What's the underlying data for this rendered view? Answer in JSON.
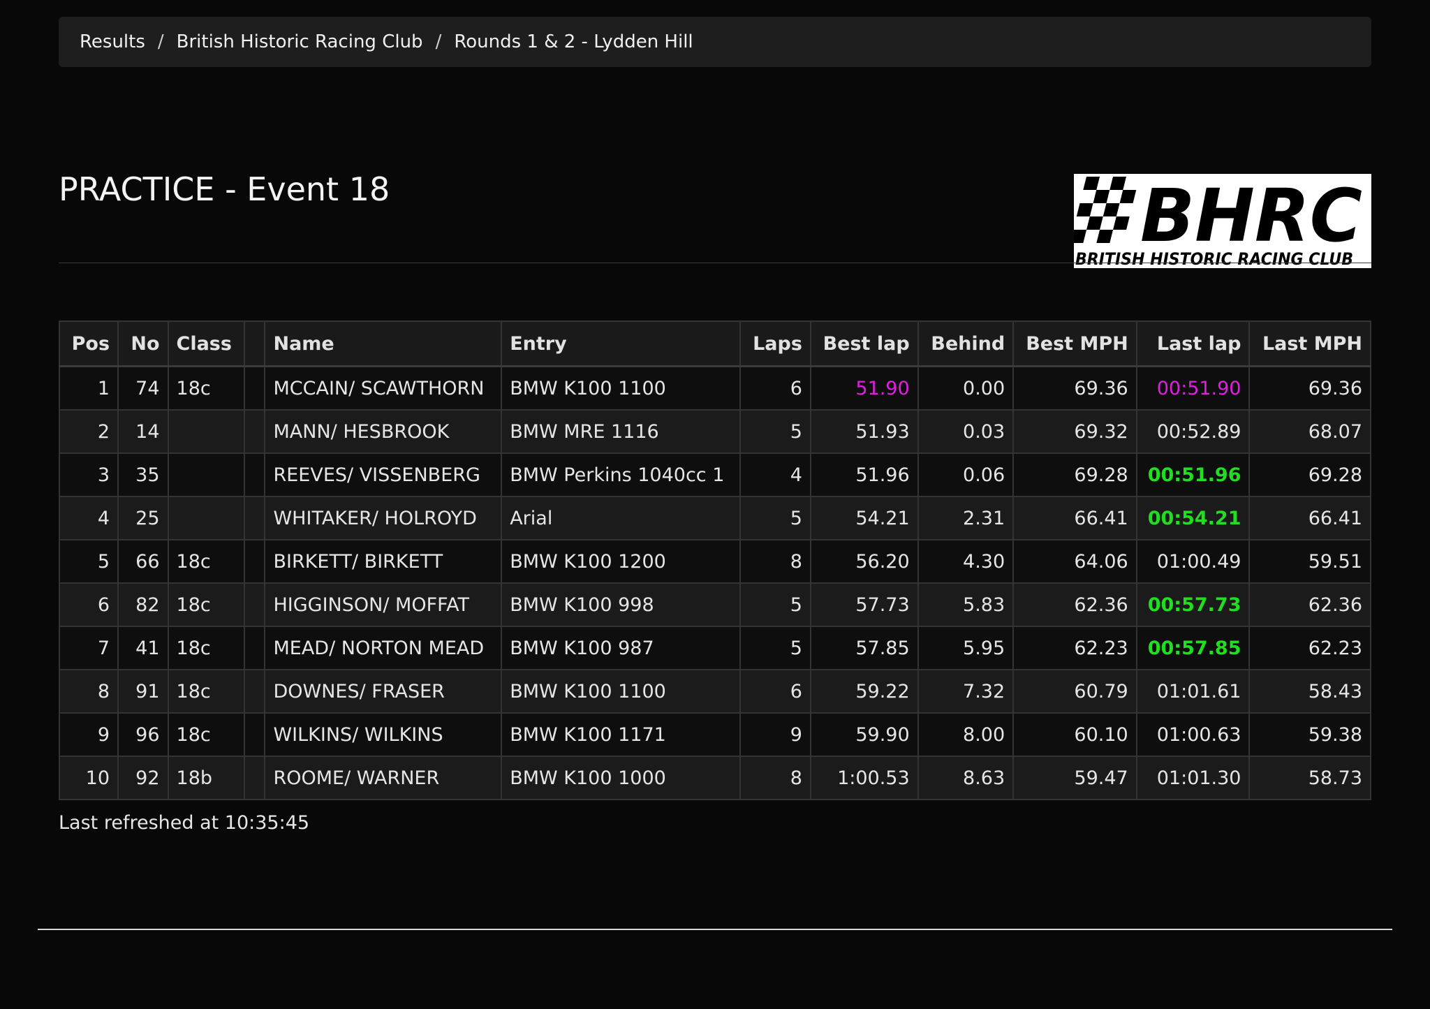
{
  "breadcrumb": [
    "Results",
    "British Historic Racing Club",
    "Rounds 1 & 2 - Lydden Hill"
  ],
  "breadcrumb_separator": "/",
  "title": "PRACTICE - Event 18",
  "logo": {
    "main_text": "BHRC",
    "sub_text": "BRITISH HISTORIC RACING CLUB"
  },
  "colors": {
    "best_overall": "#e11ee1",
    "personal_best": "#22dd22",
    "background": "#080808"
  },
  "table": {
    "headers": [
      "Pos",
      "No",
      "Class",
      "",
      "Name",
      "Entry",
      "Laps",
      "Best lap",
      "Behind",
      "Best MPH",
      "Last lap",
      "Last MPH"
    ],
    "rows": [
      {
        "pos": "1",
        "no": "74",
        "class": "18c",
        "flag": "",
        "name": "MCCAIN/ SCAWTHORN",
        "entry": "BMW K100 1100",
        "laps": "6",
        "best_lap": "51.90",
        "behind": "0.00",
        "best_mph": "69.36",
        "last_lap": "00:51.90",
        "last_mph": "69.36",
        "best_status": "overall",
        "last_status": "overall"
      },
      {
        "pos": "2",
        "no": "14",
        "class": "",
        "flag": "",
        "name": "MANN/ HESBROOK",
        "entry": "BMW MRE 1116",
        "laps": "5",
        "best_lap": "51.93",
        "behind": "0.03",
        "best_mph": "69.32",
        "last_lap": "00:52.89",
        "last_mph": "68.07",
        "best_status": "",
        "last_status": ""
      },
      {
        "pos": "3",
        "no": "35",
        "class": "",
        "flag": "",
        "name": "REEVES/ VISSENBERG",
        "entry": "BMW Perkins 1040cc 1",
        "laps": "4",
        "best_lap": "51.96",
        "behind": "0.06",
        "best_mph": "69.28",
        "last_lap": "00:51.96",
        "last_mph": "69.28",
        "best_status": "",
        "last_status": "personal"
      },
      {
        "pos": "4",
        "no": "25",
        "class": "",
        "flag": "",
        "name": "WHITAKER/ HOLROYD",
        "entry": "Arial",
        "laps": "5",
        "best_lap": "54.21",
        "behind": "2.31",
        "best_mph": "66.41",
        "last_lap": "00:54.21",
        "last_mph": "66.41",
        "best_status": "",
        "last_status": "personal"
      },
      {
        "pos": "5",
        "no": "66",
        "class": "18c",
        "flag": "",
        "name": "BIRKETT/ BIRKETT",
        "entry": "BMW K100 1200",
        "laps": "8",
        "best_lap": "56.20",
        "behind": "4.30",
        "best_mph": "64.06",
        "last_lap": "01:00.49",
        "last_mph": "59.51",
        "best_status": "",
        "last_status": ""
      },
      {
        "pos": "6",
        "no": "82",
        "class": "18c",
        "flag": "",
        "name": "HIGGINSON/ MOFFAT",
        "entry": "BMW K100 998",
        "laps": "5",
        "best_lap": "57.73",
        "behind": "5.83",
        "best_mph": "62.36",
        "last_lap": "00:57.73",
        "last_mph": "62.36",
        "best_status": "",
        "last_status": "personal"
      },
      {
        "pos": "7",
        "no": "41",
        "class": "18c",
        "flag": "",
        "name": "MEAD/ NORTON MEAD",
        "entry": "BMW K100 987",
        "laps": "5",
        "best_lap": "57.85",
        "behind": "5.95",
        "best_mph": "62.23",
        "last_lap": "00:57.85",
        "last_mph": "62.23",
        "best_status": "",
        "last_status": "personal"
      },
      {
        "pos": "8",
        "no": "91",
        "class": "18c",
        "flag": "",
        "name": "DOWNES/ FRASER",
        "entry": "BMW K100 1100",
        "laps": "6",
        "best_lap": "59.22",
        "behind": "7.32",
        "best_mph": "60.79",
        "last_lap": "01:01.61",
        "last_mph": "58.43",
        "best_status": "",
        "last_status": ""
      },
      {
        "pos": "9",
        "no": "96",
        "class": "18c",
        "flag": "",
        "name": "WILKINS/ WILKINS",
        "entry": "BMW K100 1171",
        "laps": "9",
        "best_lap": "59.90",
        "behind": "8.00",
        "best_mph": "60.10",
        "last_lap": "01:00.63",
        "last_mph": "59.38",
        "best_status": "",
        "last_status": ""
      },
      {
        "pos": "10",
        "no": "92",
        "class": "18b",
        "flag": "",
        "name": "ROOME/ WARNER",
        "entry": "BMW K100 1000",
        "laps": "8",
        "best_lap": "1:00.53",
        "behind": "8.63",
        "best_mph": "59.47",
        "last_lap": "01:01.30",
        "last_mph": "58.73",
        "best_status": "",
        "last_status": ""
      }
    ]
  },
  "footer": {
    "refreshed": "Last refreshed at 10:35:45"
  }
}
